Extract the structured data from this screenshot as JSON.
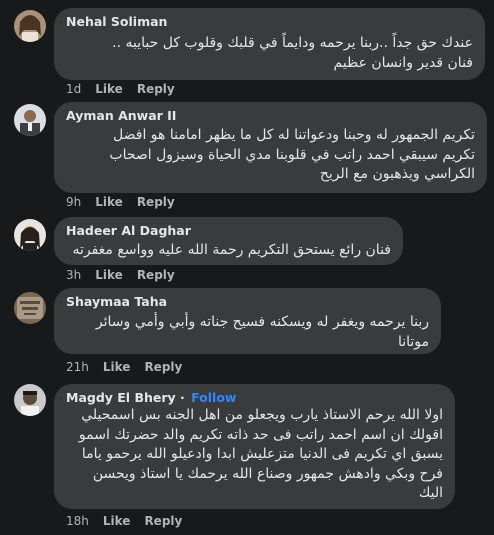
{
  "comments": [
    {
      "author": "Nehal Soliman",
      "lines": [
        "عندك حق جداً ..ربنا يرحمه ودايماً في قلبك وقلوب كل حبايبه ..",
        "فنان قدير وانسان عظيم"
      ],
      "time": "1d",
      "like": "Like",
      "reply": "Reply"
    },
    {
      "author": "Ayman Anwar II",
      "lines": [
        "تكريم الجمهور له وحبنا ودعواتنا له كل ما يظهر امامنا هو افضل",
        "تكريم سيبقي احمد راتب في قلوبنا مدي الحياة وسيزول اصحاب",
        "الكراسي ويذهبون مع الريح"
      ],
      "time": "9h",
      "like": "Like",
      "reply": "Reply"
    },
    {
      "author": "Hadeer Al Daghar",
      "lines": [
        "فنان رائع يستحق التكريم رحمة الله عليه وواسع مغفرته"
      ],
      "time": "3h",
      "like": "Like",
      "reply": "Reply"
    },
    {
      "author": "Shaymaa Taha",
      "lines": [
        "ربنا يرحمه ويغفر له ويسكنه فسيح جناته وأبي وأمي وسائر",
        "موتانا"
      ],
      "time": "21h",
      "like": "Like",
      "reply": "Reply"
    },
    {
      "author": "Magdy El Bhery",
      "follow": "Follow",
      "lines": [
        "اولا الله يرحم الاستاذ يارب ويجعلو من اهل الجنه بس اسمحيلي",
        "اقولك ان اسم احمد راتب فى حد ذاته تكريم والد حضرتك اسمو",
        "يسبق اي تكريم فى الدنيا متزعليش ابدا وادعيلو الله يرحمو ياما",
        "فرح وبكي وادهش جمهور وصناع الله يرحمك يا استاذ ويحسن",
        "اليك"
      ],
      "time": "18h",
      "like": "Like",
      "reply": "Reply"
    }
  ]
}
